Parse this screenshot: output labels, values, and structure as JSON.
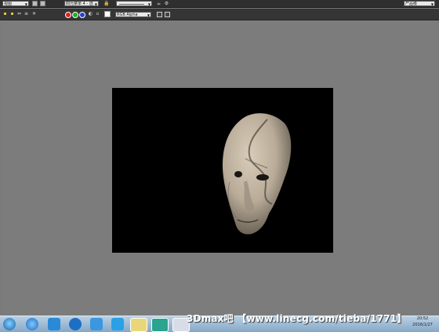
{
  "toolbar_top": {
    "view_select": "视图",
    "mode_select": "四元菜单 4 - 选",
    "preset_select": "",
    "area_select": "产品级"
  },
  "toolbar_bottom": {
    "channel_select": "RGB Alpha"
  },
  "colors": {
    "channel_red": "#e02020",
    "channel_green": "#20b020",
    "channel_blue": "#2040e0"
  },
  "overlay": {
    "watermark": "3Dmax吧 【www.linecg.com/tieba/1771】"
  },
  "clock": {
    "time": "20:52",
    "date": "2016/1/27"
  },
  "taskbar": {
    "icons": [
      "start-orb-icon",
      "ie-icon",
      "qq-icon",
      "k-app-icon",
      "bird-app-icon",
      "wifi-icon",
      "folder-icon",
      "3dsmax-icon",
      "paint-icon"
    ]
  }
}
